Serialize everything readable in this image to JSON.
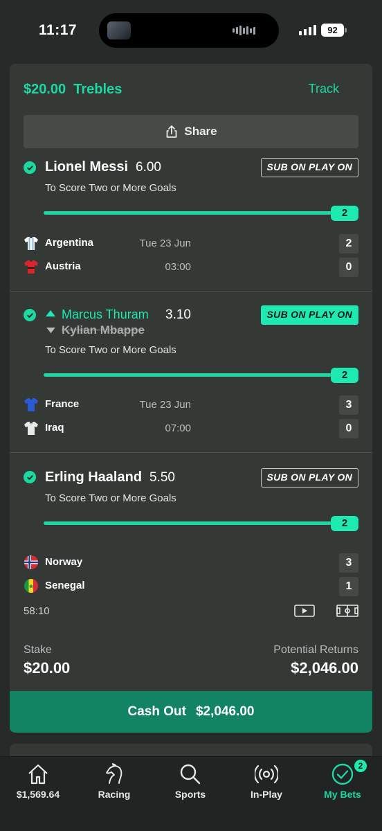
{
  "status": {
    "time": "11:17",
    "battery": "92"
  },
  "bet": {
    "title": "$20.00  Trebles",
    "track_label": "Track",
    "share_label": "Share",
    "legs": [
      {
        "player": "Lionel Messi",
        "odds": "6.00",
        "sub_label": "SUB ON PLAY ON",
        "sub_active": false,
        "market": "To Score Two or More Goals",
        "progress": "2",
        "home": {
          "name": "Argentina",
          "score": "2"
        },
        "away": {
          "name": "Austria",
          "score": "0"
        },
        "date": "Tue 23 Jun",
        "time": "03:00"
      },
      {
        "player": "Marcus Thuram",
        "replaced_player": "Kylian Mbappe",
        "odds": "3.10",
        "sub_label": "SUB ON PLAY ON",
        "sub_active": true,
        "market": "To Score Two or More Goals",
        "progress": "2",
        "home": {
          "name": "France",
          "score": "3"
        },
        "away": {
          "name": "Iraq",
          "score": "0"
        },
        "date": "Tue 23 Jun",
        "time": "07:00"
      },
      {
        "player": "Erling Haaland",
        "odds": "5.50",
        "sub_label": "SUB ON PLAY ON",
        "sub_active": false,
        "market": "To Score Two or More Goals",
        "progress": "2",
        "home": {
          "name": "Norway",
          "score": "3"
        },
        "away": {
          "name": "Senegal",
          "score": "1"
        },
        "clock": "58:10"
      }
    ],
    "stake_label": "Stake",
    "stake_value": "$20.00",
    "returns_label": "Potential Returns",
    "returns_value": "$2,046.00",
    "cashout_label": "Cash Out",
    "cashout_value": "$2,046.00"
  },
  "nav": [
    {
      "label": "$1,569.64",
      "icon": "home-icon"
    },
    {
      "label": "Racing",
      "icon": "horse-icon"
    },
    {
      "label": "Sports",
      "icon": "search-icon"
    },
    {
      "label": "In-Play",
      "icon": "broadcast-icon"
    },
    {
      "label": "My Bets",
      "icon": "check-circle-icon",
      "badge": "2",
      "active": true
    }
  ],
  "colors": {
    "accent": "#1dd8a2",
    "background": "#262a28",
    "card": "#353936",
    "cashout": "#128464"
  }
}
